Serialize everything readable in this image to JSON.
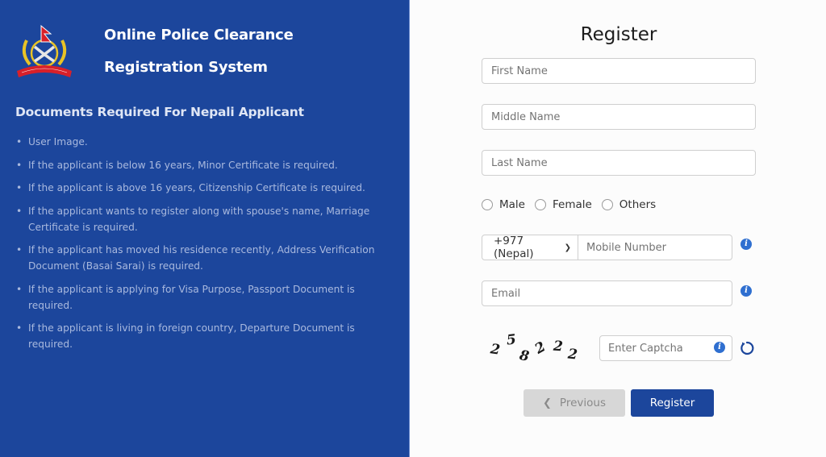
{
  "header": {
    "logo": "nepal-police-emblem",
    "title_line1": "Online Police Clearance",
    "title_line2": "Registration System"
  },
  "documents": {
    "heading": "Documents Required For Nepali Applicant",
    "items": [
      "User Image.",
      "If the applicant is below 16 years, Minor Certificate is required.",
      "If the applicant is above 16 years, Citizenship Certificate is required.",
      "If the applicant wants to register along with spouse's name, Marriage Certificate is required.",
      "If the applicant has moved his residence recently, Address Verification Document (Basai Sarai) is required.",
      "If the applicant is applying for Visa Purpose, Passport Document is required.",
      "If the applicant is living in foreign country, Departure Document is required."
    ]
  },
  "form": {
    "title": "Register",
    "first_name": {
      "value": "",
      "placeholder": "First Name"
    },
    "middle_name": {
      "value": "",
      "placeholder": "Middle Name"
    },
    "last_name": {
      "value": "",
      "placeholder": "Last Name"
    },
    "gender": {
      "options": [
        "Male",
        "Female",
        "Others"
      ],
      "selected": null
    },
    "country_code": {
      "selected": "+977 (Nepal)"
    },
    "mobile": {
      "value": "",
      "placeholder": "Mobile Number"
    },
    "email": {
      "value": "",
      "placeholder": "Email"
    },
    "captcha": {
      "chars": [
        "2",
        "5",
        "8",
        "2",
        "2",
        "2"
      ],
      "input_value": "",
      "placeholder": "Enter Captcha"
    },
    "buttons": {
      "previous": "Previous",
      "register": "Register"
    }
  },
  "colors": {
    "primary": "#1c469c",
    "info": "#2f6fd0",
    "disabled_button": "#d7d7d7"
  }
}
